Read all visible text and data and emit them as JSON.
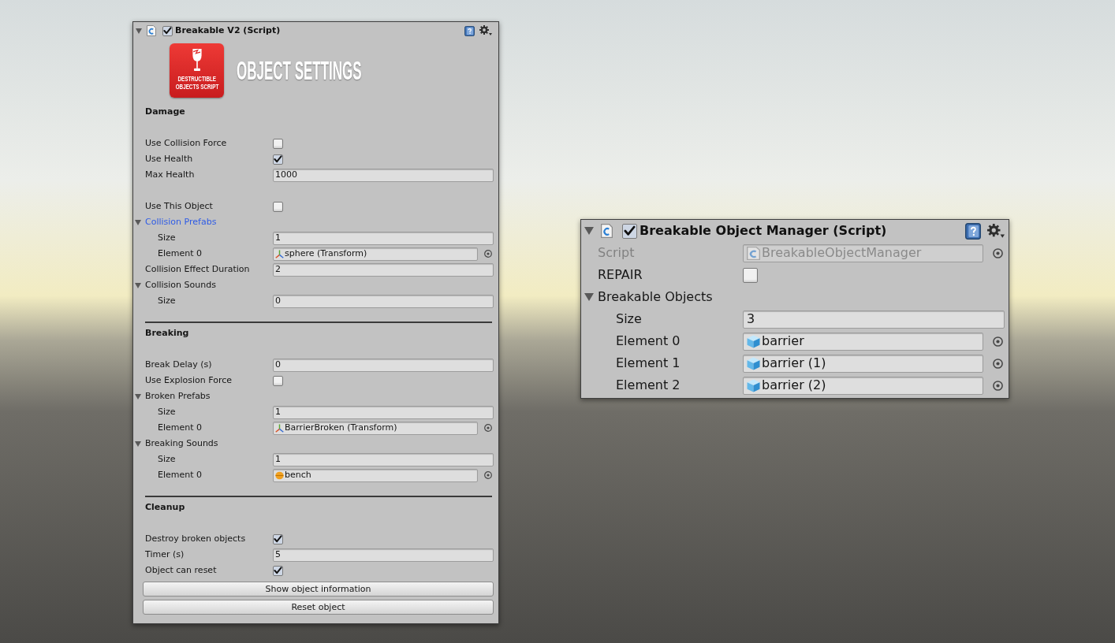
{
  "breakable_inspector": {
    "expanded": true,
    "enabled": true,
    "title": "Breakable V2 (Script)",
    "banner": {
      "logo_lines": [
        "DESTRUCTIBLE",
        "OBJECTS SCRIPT"
      ],
      "heading": "OBJECT SETTINGS"
    },
    "sections": [
      {
        "title": "Damage",
        "groups": [
          [
            {
              "kind": "checkbox",
              "label": "Use Collision Force",
              "checked": false
            },
            {
              "kind": "checkbox",
              "label": "Use Health",
              "checked": true
            },
            {
              "kind": "number",
              "label": "Max Health",
              "value": "1000"
            }
          ],
          [
            {
              "kind": "checkbox",
              "label": "Use This Object",
              "checked": false
            },
            {
              "kind": "foldout",
              "label": "Collision Prefabs",
              "expanded": true,
              "selected": true,
              "children": [
                {
                  "kind": "number",
                  "label": "Size",
                  "value": "1"
                },
                {
                  "kind": "transform",
                  "label": "Element 0",
                  "value": "sphere (Transform)"
                }
              ]
            },
            {
              "kind": "number",
              "label": "Collision Effect Duration",
              "value": "2"
            },
            {
              "kind": "foldout",
              "label": "Collision Sounds",
              "expanded": true,
              "selected": false,
              "children": [
                {
                  "kind": "number",
                  "label": "Size",
                  "value": "0"
                }
              ]
            }
          ]
        ]
      },
      {
        "title": "Breaking",
        "groups": [
          [
            {
              "kind": "number",
              "label": "Break Delay (s)",
              "value": "0"
            },
            {
              "kind": "checkbox",
              "label": "Use Explosion Force",
              "checked": false
            },
            {
              "kind": "foldout",
              "label": "Broken Prefabs",
              "expanded": true,
              "selected": false,
              "children": [
                {
                  "kind": "number",
                  "label": "Size",
                  "value": "1"
                },
                {
                  "kind": "transform",
                  "label": "Element 0",
                  "value": "BarrierBroken (Transform)"
                }
              ]
            },
            {
              "kind": "foldout",
              "label": "Breaking Sounds",
              "expanded": true,
              "selected": false,
              "children": [
                {
                  "kind": "number",
                  "label": "Size",
                  "value": "1"
                },
                {
                  "kind": "audio",
                  "label": "Element 0",
                  "value": "bench"
                }
              ]
            }
          ]
        ]
      },
      {
        "title": "Cleanup",
        "groups": [
          [
            {
              "kind": "checkbox",
              "label": "Destroy broken objects",
              "checked": true
            },
            {
              "kind": "number",
              "label": "Timer (s)",
              "value": "5"
            },
            {
              "kind": "checkbox",
              "label": "Object can reset",
              "checked": true
            }
          ]
        ]
      }
    ],
    "buttons": [
      "Show object information",
      "Reset object"
    ]
  },
  "manager_inspector": {
    "expanded": true,
    "enabled": true,
    "title": "Breakable Object Manager (Script)",
    "rows": [
      {
        "kind": "script",
        "label": "Script",
        "value": "BreakableObjectManager",
        "disabled": true
      },
      {
        "kind": "checkbox",
        "label": "REPAIR",
        "checked": false
      },
      {
        "kind": "foldout",
        "label": "Breakable Objects",
        "expanded": true,
        "selected": false,
        "children": [
          {
            "kind": "number",
            "label": "Size",
            "value": "3"
          },
          {
            "kind": "prefab",
            "label": "Element 0",
            "value": "barrier"
          },
          {
            "kind": "prefab",
            "label": "Element 1",
            "value": "barrier (1)"
          },
          {
            "kind": "prefab",
            "label": "Element 2",
            "value": "barrier (2)"
          }
        ]
      }
    ]
  }
}
